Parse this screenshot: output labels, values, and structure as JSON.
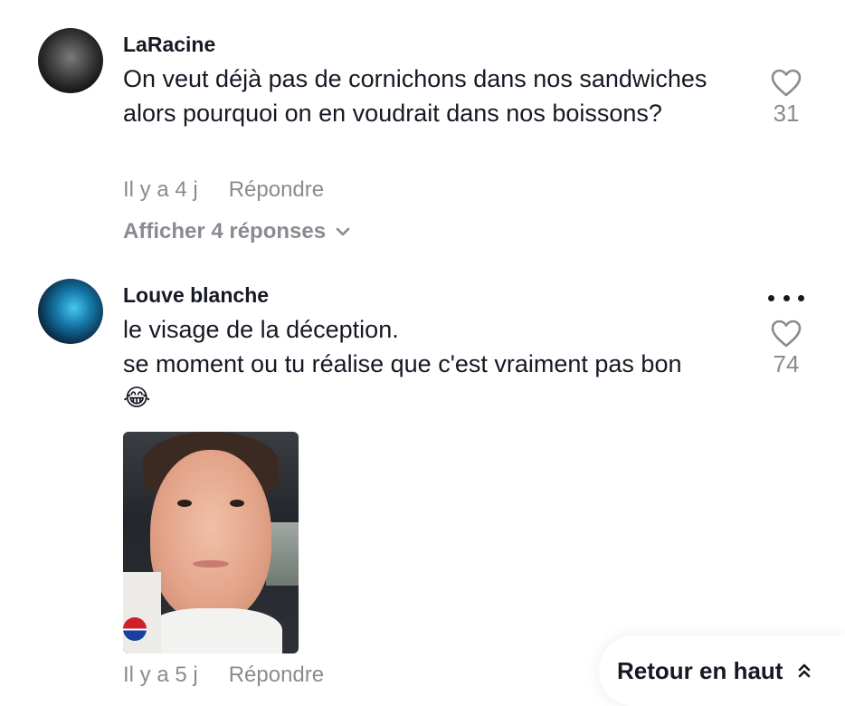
{
  "comments": [
    {
      "username": "LaRacine",
      "text": "On veut déjà pas de cornichons dans nos sandwiches alors pourquoi on en voudrait dans nos boissons?",
      "time": "Il y a 4 j",
      "reply_label": "Répondre",
      "likes": "31",
      "show_replies_label": "Afficher 4 réponses"
    },
    {
      "username": "Louve blanche",
      "text_line1": "le visage de la déception.",
      "text_line2": "se moment ou tu réalise que c'est vraiment pas bon",
      "emoji": "😂",
      "time": "Il y a 5 j",
      "reply_label": "Répondre",
      "likes": "74"
    }
  ],
  "back_to_top": {
    "label": "Retour en haut"
  },
  "icons": {
    "like": "heart-outline-icon",
    "expand": "chevron-down-icon",
    "more": "more-horizontal-icon",
    "back_to_top": "double-chevron-up-icon"
  },
  "colors": {
    "text": "#161823",
    "muted": "#8a8b91",
    "background": "#ffffff"
  }
}
